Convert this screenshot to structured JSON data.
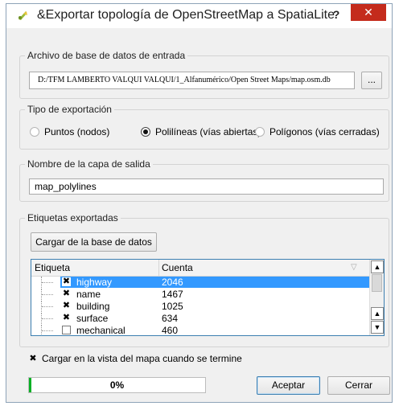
{
  "window": {
    "title": "&Exportar topología de OpenStreetMap a SpatiaLite",
    "help_label": "?",
    "close_label": "✕"
  },
  "input_db": {
    "legend": "Archivo de base de datos de entrada",
    "path": "D:/TFM LAMBERTO VALQUI VALQUI/1_Alfanumérico/Open Street Maps/map.osm.db",
    "browse_label": "..."
  },
  "export_type": {
    "legend": "Tipo de exportación",
    "options": [
      {
        "label": "Puntos (nodos)",
        "selected": false
      },
      {
        "label": "Polilíneas (vías abiertas)",
        "selected": true
      },
      {
        "label": "Polígonos (vías cerradas)",
        "selected": false
      }
    ]
  },
  "output_layer": {
    "legend": "Nombre de la capa de salida",
    "value": "map_polylines"
  },
  "tags": {
    "legend": "Etiquetas exportadas",
    "load_button": "Cargar de la base de datos",
    "columns": [
      "Etiqueta",
      "Cuenta"
    ],
    "rows": [
      {
        "tag": "highway",
        "count": "2046",
        "checked": true,
        "selected": true
      },
      {
        "tag": "name",
        "count": "1467",
        "checked": true,
        "selected": false
      },
      {
        "tag": "building",
        "count": "1025",
        "checked": true,
        "selected": false
      },
      {
        "tag": "surface",
        "count": "634",
        "checked": true,
        "selected": false
      },
      {
        "tag": "mechanical",
        "count": "460",
        "checked": false,
        "selected": false
      }
    ]
  },
  "load_in_map": {
    "label": "Cargar en la vista del mapa cuando se termine",
    "checked": true
  },
  "progress": {
    "text": "0%",
    "value": 0
  },
  "buttons": {
    "accept": "Aceptar",
    "close": "Cerrar"
  },
  "colors": {
    "close_red": "#c42b1c",
    "selection": "#3399ff",
    "progress_green": "#06b025"
  }
}
